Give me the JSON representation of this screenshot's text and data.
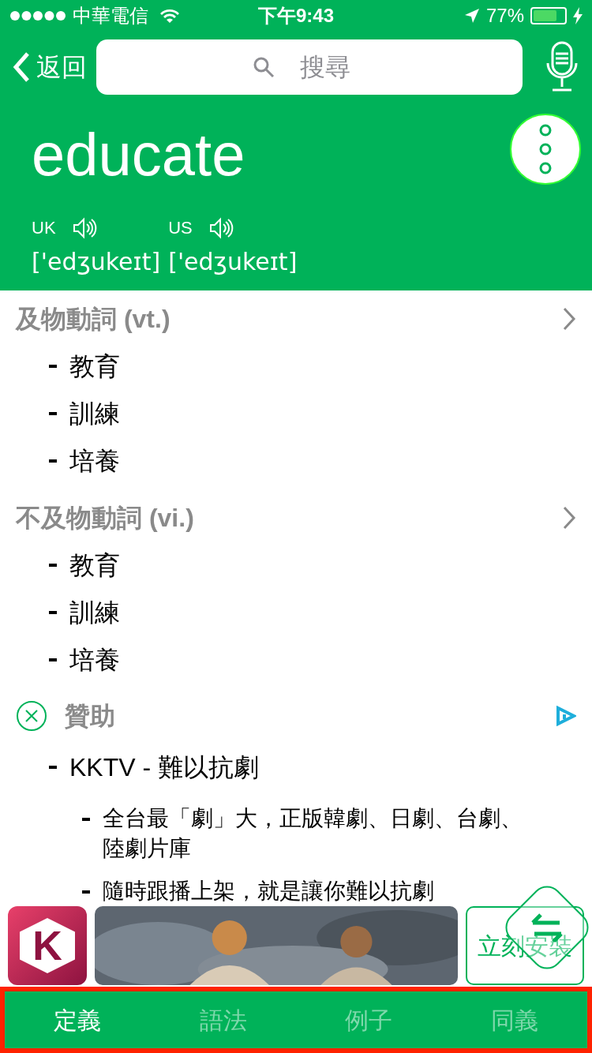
{
  "status_bar": {
    "carrier": "中華電信",
    "time": "下午9:43",
    "battery": "77%"
  },
  "nav": {
    "back": "返回",
    "search": {
      "placeholder": "搜尋"
    }
  },
  "word": {
    "headword": "educate",
    "pronunciations": [
      {
        "region": "UK",
        "ipa": "['edʒukeɪt]"
      },
      {
        "region": "US",
        "ipa": "['edʒukeɪt]"
      }
    ]
  },
  "sections": [
    {
      "heading": "及物動詞 (vt.)",
      "senses": [
        "教育",
        "訓練",
        "培養"
      ]
    },
    {
      "heading": "不及物動詞 (vi.)",
      "senses": [
        "教育",
        "訓練",
        "培養"
      ]
    }
  ],
  "sponsor": {
    "heading": "贊助",
    "title": "KKTV - 難以抗劇",
    "points": [
      "全台最「劇」大，正版韓劇、日劇、台劇、陸劇片庫",
      "隨時跟播上架，就是讓你難以抗劇"
    ],
    "install": "立刻安裝",
    "app_letter": "K"
  },
  "tabs": [
    {
      "label": "定義",
      "selected": true
    },
    {
      "label": "語法",
      "selected": false
    },
    {
      "label": "例子",
      "selected": false
    },
    {
      "label": "同義",
      "selected": false
    }
  ]
}
